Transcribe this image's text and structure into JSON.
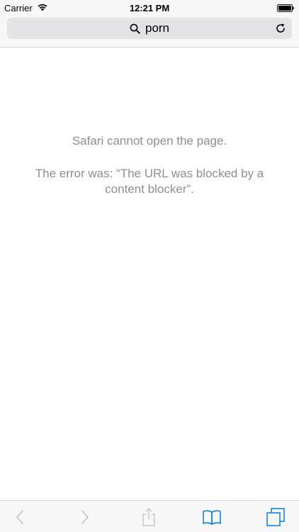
{
  "status_bar": {
    "carrier": "Carrier",
    "time": "12:21 PM",
    "icons": [
      "wifi-icon",
      "battery-icon"
    ]
  },
  "address_bar": {
    "text": "porn",
    "icons": [
      "search-icon",
      "reload-icon"
    ]
  },
  "error": {
    "title": "Safari cannot open the page.",
    "detail": "The error was: “The URL was blocked by a content blocker”."
  },
  "toolbar": {
    "items": [
      "back-icon",
      "forward-icon",
      "share-icon",
      "bookmarks-icon",
      "tabs-icon"
    ]
  },
  "colors": {
    "accent": "#007aff",
    "disabled": "#c7c7cc",
    "error_text": "#8e8e93",
    "bar_bg": "#f7f7f7",
    "field_bg": "#e3e3e5"
  }
}
